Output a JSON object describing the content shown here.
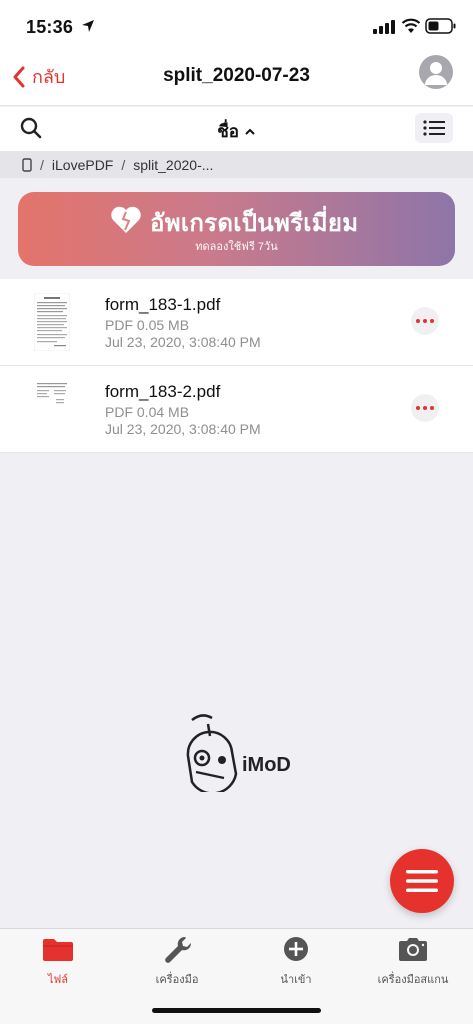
{
  "status": {
    "time": "15:36"
  },
  "nav": {
    "back_label": "กลับ",
    "title": "split_2020-07-23"
  },
  "toolbar": {
    "sort_label": "ชื่อ",
    "sort_arrow": "^"
  },
  "breadcrumb": {
    "items": [
      "iLovePDF",
      "split_2020-..."
    ],
    "separator": "/"
  },
  "promo": {
    "title": "อัพเกรดเป็นพรีเมี่ยม",
    "subtitle": "ทดลองใช้ฟรี 7วัน"
  },
  "files": [
    {
      "name": "form_183-1.pdf",
      "meta": "PDF  0.05 MB",
      "date": "Jul 23, 2020, 3:08:40 PM"
    },
    {
      "name": "form_183-2.pdf",
      "meta": "PDF  0.04 MB",
      "date": "Jul 23, 2020, 3:08:40 PM"
    }
  ],
  "watermark": {
    "text": "iMoD"
  },
  "tabs": [
    {
      "label": "ไฟล์",
      "icon": "folder-icon",
      "active": true
    },
    {
      "label": "เครื่องมือ",
      "icon": "wrench-icon",
      "active": false
    },
    {
      "label": "นำเข้า",
      "icon": "plus-circle-icon",
      "active": false
    },
    {
      "label": "เครื่องมือสแกน",
      "icon": "camera-icon",
      "active": false
    }
  ],
  "colors": {
    "accent": "#e5322d",
    "promo_start": "#e4746b",
    "promo_end": "#8e75a8"
  }
}
